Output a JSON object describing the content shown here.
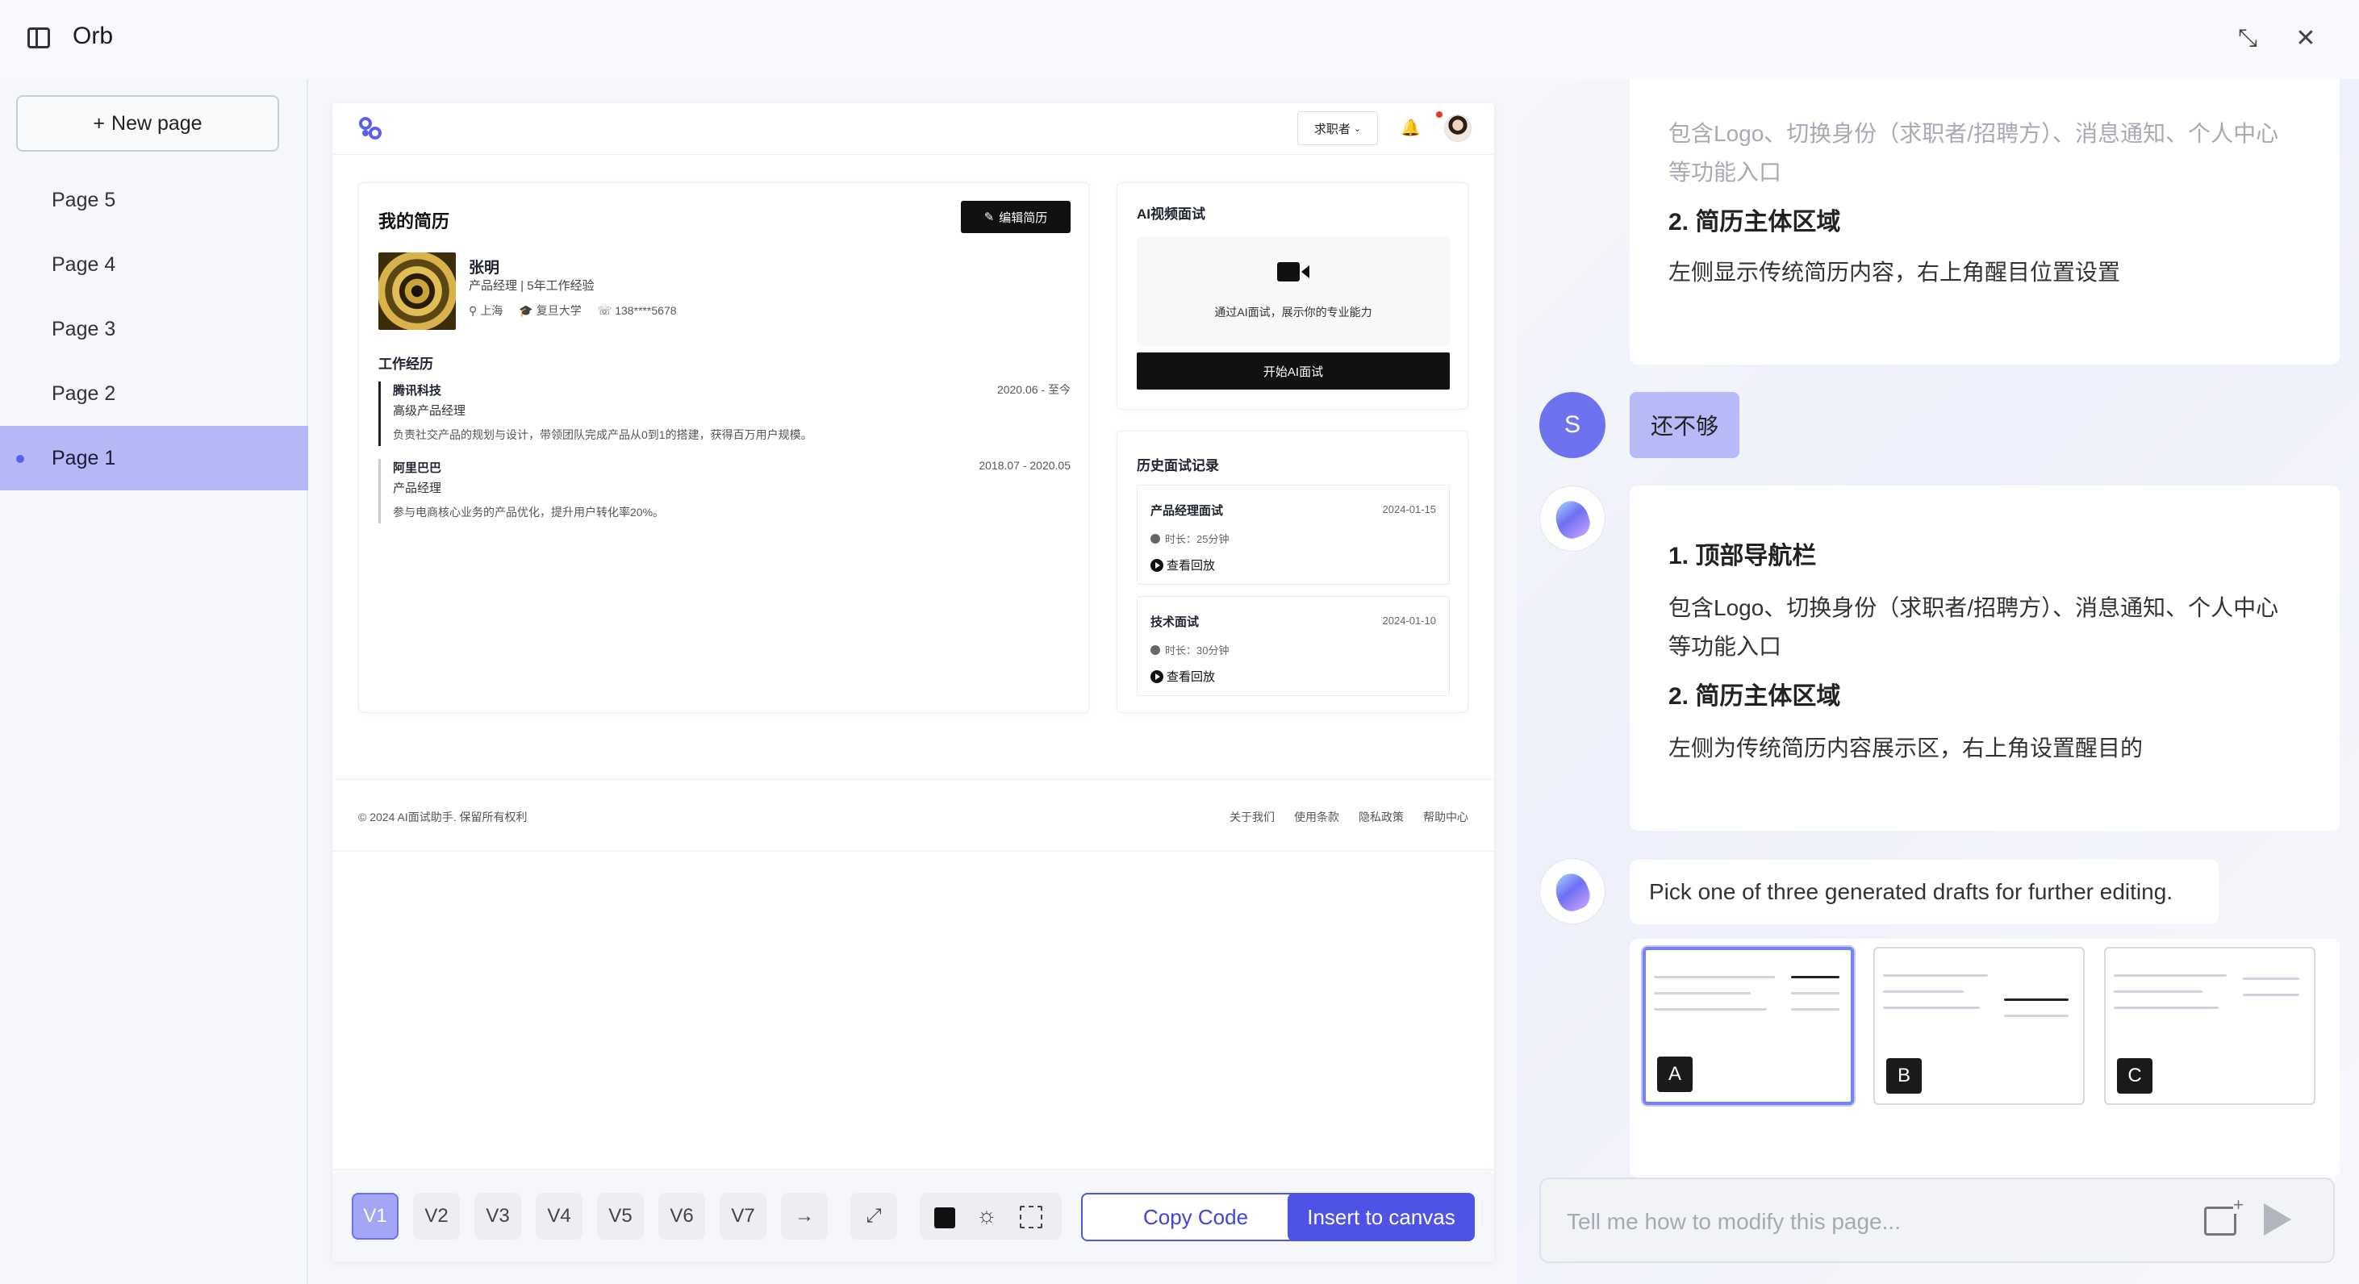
{
  "app": {
    "title": "Orb"
  },
  "sidebar": {
    "new_page_label": "New page",
    "pages": [
      {
        "label": "Page 5",
        "active": false
      },
      {
        "label": "Page 4",
        "active": false
      },
      {
        "label": "Page 3",
        "active": false
      },
      {
        "label": "Page 2",
        "active": false
      },
      {
        "label": "Page 1",
        "active": true
      }
    ]
  },
  "preview": {
    "role_switch": "求职者",
    "resume": {
      "title": "我的简历",
      "edit_label": "编辑简历",
      "name": "张明",
      "role": "产品经理 | 5年工作经验",
      "location": "上海",
      "school": "复旦大学",
      "phone": "138****5678",
      "section_title": "工作经历",
      "jobs": [
        {
          "company": "腾讯科技",
          "title": "高级产品经理",
          "period": "2020.06 - 至今",
          "desc": "负责社交产品的规划与设计，带领团队完成产品从0到1的搭建，获得百万用户规模。"
        },
        {
          "company": "阿里巴巴",
          "title": "产品经理",
          "period": "2018.07 - 2020.05",
          "desc": "参与电商核心业务的产品优化，提升用户转化率20%。"
        }
      ]
    },
    "ai_interview": {
      "title": "AI视频面试",
      "desc": "通过AI面试，展示你的专业能力",
      "start_label": "开始AI面试"
    },
    "history": {
      "title": "历史面试记录",
      "items": [
        {
          "name": "产品经理面试",
          "date": "2024-01-15",
          "duration": "时长：25分钟",
          "play": "查看回放"
        },
        {
          "name": "技术面试",
          "date": "2024-01-10",
          "duration": "时长：30分钟",
          "play": "查看回放"
        }
      ]
    },
    "footer": {
      "copyright": "© 2024 AI面试助手. 保留所有权利",
      "links": [
        "关于我们",
        "使用条款",
        "隐私政策",
        "帮助中心"
      ]
    }
  },
  "toolbar": {
    "versions": [
      "V1",
      "V2",
      "V3",
      "V4",
      "V5",
      "V6",
      "V7"
    ],
    "active_version": "V1",
    "copy_code_label": "Copy Code",
    "insert_label": "Insert to canvas"
  },
  "chat": {
    "prev_message": {
      "line1": "包含Logo、切换身份（求职者/招聘方）、消息通知、个人中心",
      "line2": "等功能入口",
      "heading2": "2. 简历主体区域",
      "line3": "左侧显示传统简历内容，右上角醒目位置设置"
    },
    "user_initial": "S",
    "user_message": "还不够",
    "bot_message": {
      "heading1": "1. 顶部导航栏",
      "line1": "包含Logo、切换身份（求职者/招聘方）、消息通知、个人中心",
      "line2": "等功能入口",
      "heading2": "2. 简历主体区域",
      "line3": "左侧为传统简历内容展示区，右上角设置醒目的"
    },
    "pick_message": "Pick one of three generated drafts for further editing.",
    "drafts": [
      "A",
      "B",
      "C"
    ],
    "selected_draft": "A",
    "input_placeholder": "Tell me how to modify this page..."
  }
}
